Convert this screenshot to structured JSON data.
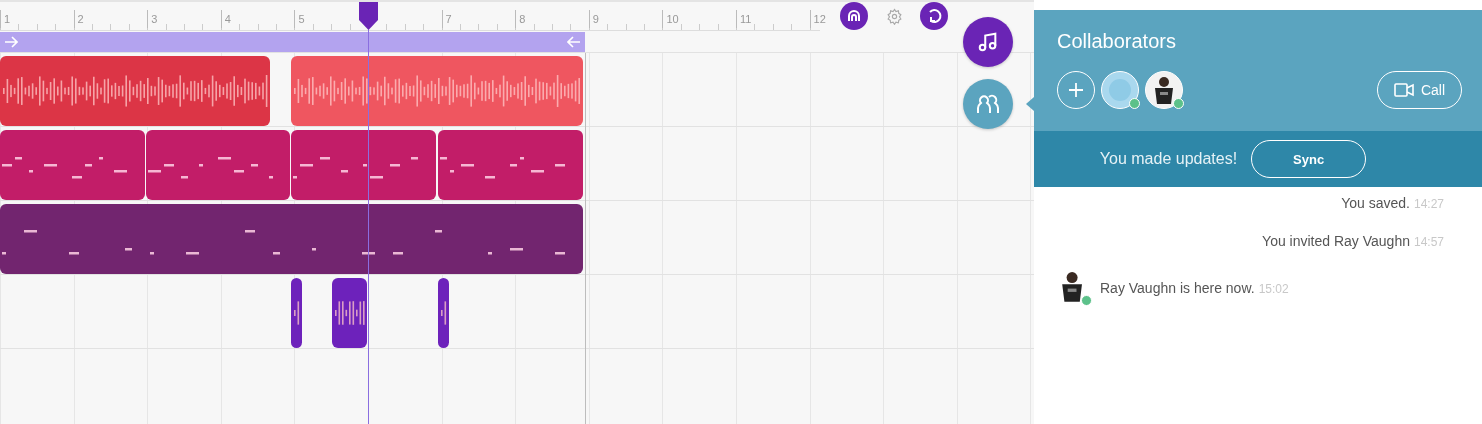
{
  "ruler": {
    "marks": [
      {
        "label": "1"
      },
      {
        "label": "2"
      },
      {
        "label": "3"
      },
      {
        "label": "4"
      },
      {
        "label": "5"
      },
      {
        "label": "7"
      },
      {
        "label": "8"
      },
      {
        "label": "9"
      },
      {
        "label": "10"
      },
      {
        "label": "11"
      },
      {
        "label": "12"
      }
    ]
  },
  "toolbar": [
    {
      "kind": "headphones",
      "on": true
    },
    {
      "kind": "settings",
      "on": false
    },
    {
      "kind": "loop",
      "on": true
    }
  ],
  "side_buttons": [
    {
      "kind": "instruments",
      "selected": false
    },
    {
      "kind": "collaborators",
      "selected": true
    }
  ],
  "tracks": [
    {
      "kind": "audio",
      "clips": [
        {
          "color": "#dc3546"
        },
        {
          "color": "#ef5660"
        }
      ]
    },
    {
      "kind": "midi",
      "clips": [
        {
          "color": "#c21d68"
        },
        {
          "color": "#c21d68"
        },
        {
          "color": "#c21d68"
        },
        {
          "color": "#c21d68"
        }
      ]
    },
    {
      "kind": "midi",
      "clips": [
        {
          "color": "#72256f"
        }
      ]
    },
    {
      "kind": "audio",
      "clips": [
        {
          "color": "#6d22bb"
        },
        {
          "color": "#6d22bb"
        },
        {
          "color": "#6d22bb"
        }
      ]
    }
  ],
  "collaborators": {
    "title": "Collaborators",
    "members": [
      {
        "kind": "default",
        "online": true
      },
      {
        "kind": "photo",
        "online": true
      }
    ],
    "call_button": "Call",
    "notice": "You made updates!",
    "sync_button": "Sync",
    "messages": [
      {
        "kind": "self",
        "text": "You saved.",
        "time": "14:27"
      },
      {
        "kind": "self",
        "text": "You invited Ray Vaughn",
        "time": "14:57"
      },
      {
        "kind": "user",
        "text": "Ray Vaughn is here now.",
        "time": "15:02",
        "online": true
      }
    ]
  }
}
